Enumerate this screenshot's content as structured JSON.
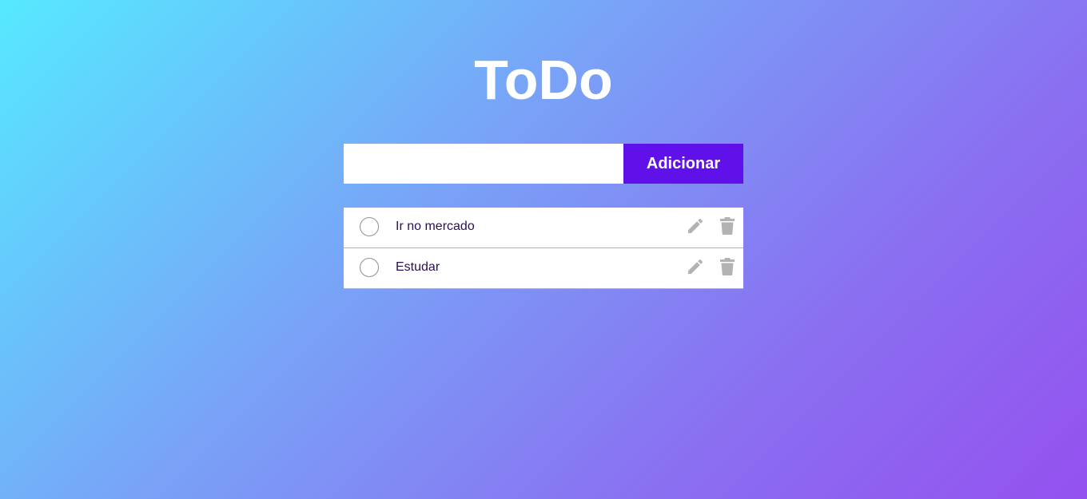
{
  "app": {
    "title": "ToDo"
  },
  "form": {
    "input_value": "",
    "input_placeholder": "",
    "add_button_label": "Adicionar"
  },
  "tasks": [
    {
      "text": "Ir no mercado",
      "completed": false
    },
    {
      "text": "Estudar",
      "completed": false
    }
  ],
  "icons": {
    "check": "circle-checkbox-icon",
    "edit": "pencil-icon",
    "delete": "trash-icon"
  },
  "colors": {
    "background_gradient": [
      "#56e9ff",
      "#9451ef"
    ],
    "accent": "#6011ea",
    "icon": "#b3b3b3",
    "task_text": "#2c0f52"
  }
}
